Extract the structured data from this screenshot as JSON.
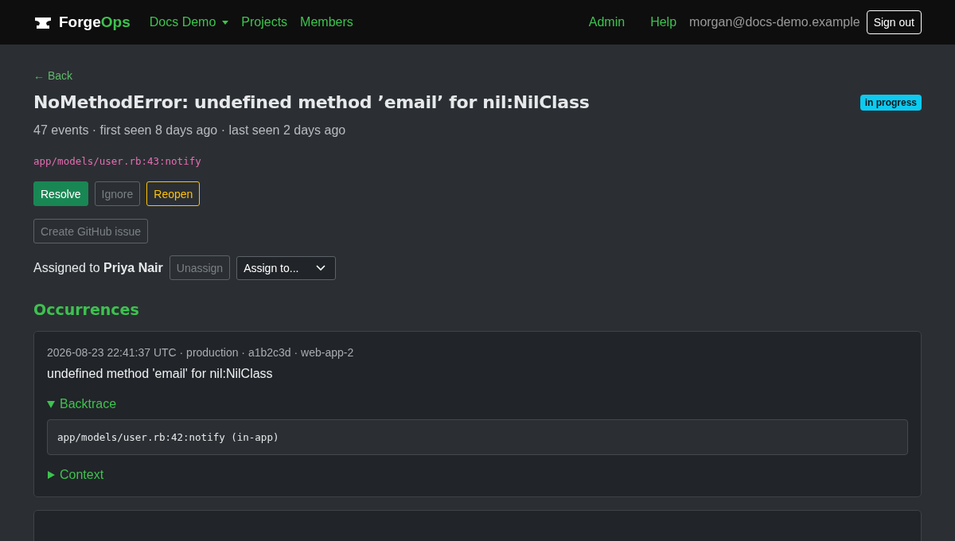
{
  "navbar": {
    "brand_first": "Forge",
    "brand_second": "Ops",
    "menu": [
      {
        "label": "Docs Demo",
        "dropdown": true
      },
      {
        "label": "Projects",
        "dropdown": false
      },
      {
        "label": "Members",
        "dropdown": false
      }
    ],
    "right_links": [
      "Admin",
      "Help"
    ],
    "user_email": "morgan@docs-demo.example",
    "sign_out": "Sign out"
  },
  "back_link": "← Back",
  "issue": {
    "title": "NoMethodError: undefined method ’email’ for nil:NilClass",
    "status": "in progress",
    "summary": "47 events · first seen 8 days ago · last seen 2 days ago",
    "location": "app/models/user.rb:43:notify"
  },
  "actions": [
    {
      "label": "Resolve",
      "kind": "primary",
      "disabled": false
    },
    {
      "label": "Ignore",
      "kind": "plain",
      "disabled": true
    },
    {
      "label": "Reopen",
      "kind": "warning",
      "disabled": false
    }
  ],
  "github_button": {
    "label": "Create GitHub issue",
    "disabled": true
  },
  "assignment": {
    "text": "Assigned to **Priya Nair**",
    "unassign": {
      "label": "Unassign",
      "disabled": true
    },
    "assign_select": "Assign to..."
  },
  "occurrences_heading": "Occurrences",
  "occurrences": [
    {
      "meta": "2026-08-23 22:41:37 UTC · production · a1b2c3d · web-app-2",
      "message": "undefined method 'email' for nil:NilClass",
      "sections": [
        {
          "label": "Backtrace",
          "expanded": true,
          "lines": [
            "app/models/user.rb:42:notify (in-app)"
          ]
        },
        {
          "label": "Context",
          "expanded": false
        }
      ]
    },
    {
      "cut_off": true
    }
  ]
}
